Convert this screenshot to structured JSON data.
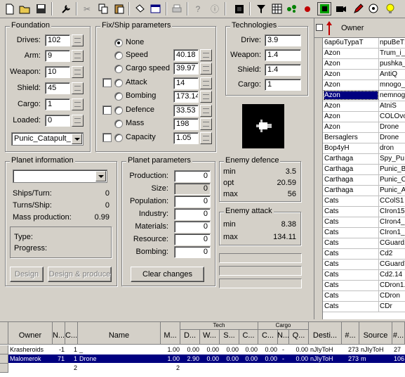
{
  "toolbar": {
    "icons": [
      "new-file-icon",
      "open-folder-icon",
      "save-icon",
      "wrench-icon",
      "cut-icon",
      "copy-icon",
      "paste-icon",
      "filter-icon",
      "window-icon",
      "print-icon",
      "help-icon",
      "info-icon",
      "black-square-icon",
      "funnel-icon",
      "grid-icon",
      "molecule-icon",
      "red-dot-icon",
      "green-cell-icon",
      "film-icon",
      "pencil-icon",
      "lightbulb-icon"
    ]
  },
  "foundation": {
    "title": "Foundation",
    "drives_label": "Drives:",
    "drives": "102",
    "arm_label": "Arm:",
    "arm": "9",
    "weapon_label": "Weapon:",
    "weapon": "10",
    "shield_label": "Shield:",
    "shield": "45",
    "cargo_label": "Cargo:",
    "cargo": "1",
    "loaded_label": "Loaded:",
    "loaded": "0",
    "design_select": "Punic_Catapult_"
  },
  "fix_ship": {
    "title": "Fix/Ship parameters",
    "none_label": "None",
    "speed_label": "Speed",
    "speed": "40.18",
    "cargo_speed_label": "Cargo speed",
    "cargo_speed": "39.97",
    "attack_label": "Attack",
    "attack": "14",
    "bombing_label": "Bombing",
    "bombing": "173.14",
    "defence_label": "Defence",
    "defence": "33.53",
    "mass_label": "Mass",
    "mass": "198",
    "capacity_label": "Capacity",
    "capacity": "1.05"
  },
  "technologies": {
    "title": "Technologies",
    "drive_label": "Drive:",
    "drive": "3.9",
    "weapon_label": "Weapon:",
    "weapon": "1.4",
    "shield_label": "Shield:",
    "shield": "1.4",
    "cargo_label": "Cargo:",
    "cargo": "1"
  },
  "planet_info": {
    "title": "Planet information",
    "ships_turn_label": "Ships/Turn:",
    "ships_turn": "0",
    "turns_ship_label": "Turns/Ship:",
    "turns_ship": "0",
    "mass_prod_label": "Mass production:",
    "mass_prod": "0.99",
    "type_label": "Type:",
    "progress_label": "Progress:",
    "design_btn": "Design",
    "design_produce_btn": "Design & produce"
  },
  "planet_params": {
    "title": "Planet parameters",
    "production_label": "Production:",
    "production": "0",
    "size_label": "Size:",
    "size": "0",
    "population_label": "Population:",
    "population": "0",
    "industry_label": "Industry:",
    "industry": "0",
    "materials_label": "Materials:",
    "materials": "0",
    "resource_label": "Resource:",
    "resource": "0",
    "bombing_label": "Bombing:",
    "bombing": "0",
    "clear_btn": "Clear changes"
  },
  "enemy_defence": {
    "title": "Enemy defence",
    "min_label": "min",
    "min": "3.5",
    "opt_label": "opt",
    "opt": "20.59",
    "max_label": "max",
    "max": "56"
  },
  "enemy_attack": {
    "title": "Enemy attack",
    "min_label": "min",
    "min": "8.38",
    "max_label": "max",
    "max": "134.11"
  },
  "owner_grid": {
    "header": "Owner",
    "rows": [
      [
        "6ap6uTypaT",
        "npuBeT!"
      ],
      [
        "Azon",
        "Trum_i_"
      ],
      [
        "Azon",
        "pushka_"
      ],
      [
        "Azon",
        "AntiQ"
      ],
      [
        "Azon",
        "mnogo_"
      ],
      [
        "Azon",
        "nemnogo"
      ],
      [
        "Azon",
        "AtniS"
      ],
      [
        "Azon",
        "COLOvo"
      ],
      [
        "Azon",
        "Drone"
      ],
      [
        "Bersaglers",
        "Drone"
      ],
      [
        "Bop4yH",
        "dron"
      ],
      [
        "Carthaga",
        "Spy_Pu"
      ],
      [
        "Carthaga",
        "Punic_Ba"
      ],
      [
        "Carthaga",
        "Punic_Ca"
      ],
      [
        "Carthaga",
        "Punic_Ar"
      ],
      [
        "Cats",
        "CColS1"
      ],
      [
        "Cats",
        "CIron15"
      ],
      [
        "Cats",
        "CIron4_"
      ],
      [
        "Cats",
        "CIron1_"
      ],
      [
        "Cats",
        "CGuard1"
      ],
      [
        "Cats",
        "Cd2"
      ],
      [
        "Cats",
        "CGuard7"
      ],
      [
        "Cats",
        "Cd2.14"
      ],
      [
        "Cats",
        "CDron1."
      ],
      [
        "Cats",
        "CDron"
      ],
      [
        "Cats",
        "CDr"
      ]
    ]
  },
  "bottom_table": {
    "headers": {
      "owner": "Owner",
      "n": "N...",
      "c": "C...",
      "name": "Name",
      "m": "M...",
      "tech": "Tech",
      "cargo": "Cargo",
      "d": "D...",
      "w": "W...",
      "s": "S...",
      "c2": "C...",
      "c3": "C...",
      "n2": "N...",
      "q": "Q...",
      "dest": "Desti...",
      "num": "#...",
      "source": "Source",
      "num2": "#..."
    },
    "rows": [
      {
        "owner": "Krasheroids",
        "n": "-1",
        "c": "1",
        "name": "_",
        "m": "1.00",
        "d": "0.00",
        "w": "0.00",
        "s": "0.00",
        "c2": "0.00",
        "c3": "0.00",
        "n2": "-",
        "q": "0.00",
        "dest": "nJIyToH",
        "num": "273",
        "source": "nJIyToH",
        "num2": "27"
      },
      {
        "owner": "Malomerok",
        "n": "71",
        "c": "1",
        "name": "Drone",
        "m": "1.00",
        "d": "2.90",
        "w": "0.00",
        "s": "0.00",
        "c2": "0.00",
        "c3": "0.00",
        "n2": "-",
        "q": "0.00",
        "dest": "nJIyToH",
        "num": "273",
        "source": "m",
        "num2": "106"
      },
      {
        "owner": "",
        "n": "",
        "c": "2",
        "name": "",
        "m": "2",
        "d": "",
        "w": "",
        "s": "",
        "c2": "",
        "c3": "",
        "n2": "",
        "q": "",
        "dest": "",
        "num": "",
        "source": "",
        "num2": ""
      }
    ]
  }
}
